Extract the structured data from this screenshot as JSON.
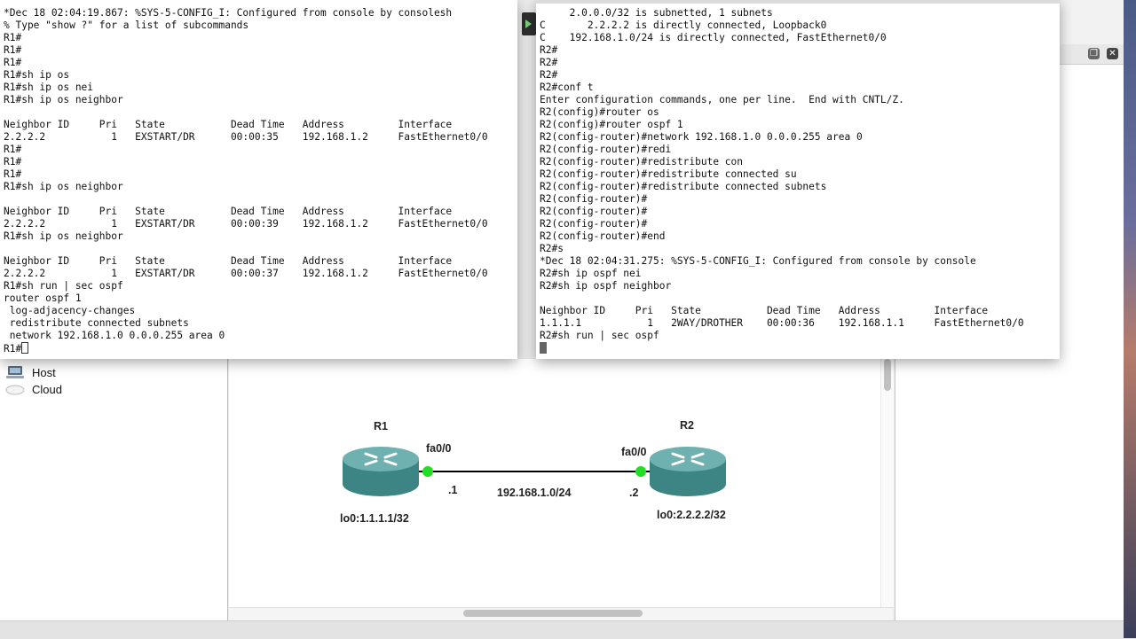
{
  "left_panel": {
    "devices": [
      {
        "label": "Host",
        "icon": "computer-icon"
      },
      {
        "label": "Cloud",
        "icon": "cloud-icon"
      }
    ]
  },
  "terminal_r1": {
    "lines": [
      "*Dec 18 02:04:19.867: %SYS-5-CONFIG_I: Configured from console by consolesh",
      "% Type \"show ?\" for a list of subcommands",
      "R1#",
      "R1#",
      "R1#",
      "R1#sh ip os",
      "R1#sh ip os nei",
      "R1#sh ip os neighbor",
      "",
      "Neighbor ID     Pri   State           Dead Time   Address         Interface",
      "2.2.2.2           1   EXSTART/DR      00:00:35    192.168.1.2     FastEthernet0/0",
      "R1#",
      "R1#",
      "R1#",
      "R1#sh ip os neighbor",
      "",
      "Neighbor ID     Pri   State           Dead Time   Address         Interface",
      "2.2.2.2           1   EXSTART/DR      00:00:39    192.168.1.2     FastEthernet0/0",
      "R1#sh ip os neighbor",
      "",
      "Neighbor ID     Pri   State           Dead Time   Address         Interface",
      "2.2.2.2           1   EXSTART/DR      00:00:37    192.168.1.2     FastEthernet0/0",
      "R1#sh run | sec ospf",
      "router ospf 1",
      " log-adjacency-changes",
      " redistribute connected subnets",
      " network 192.168.1.0 0.0.0.255 area 0"
    ],
    "prompt": "R1#"
  },
  "terminal_r2": {
    "lines": [
      "     2.0.0.0/32 is subnetted, 1 subnets",
      "C       2.2.2.2 is directly connected, Loopback0",
      "C    192.168.1.0/24 is directly connected, FastEthernet0/0",
      "R2#",
      "R2#",
      "R2#",
      "R2#conf t",
      "Enter configuration commands, one per line.  End with CNTL/Z.",
      "R2(config)#router os",
      "R2(config)#router ospf 1",
      "R2(config-router)#network 192.168.1.0 0.0.0.255 area 0",
      "R2(config-router)#redi",
      "R2(config-router)#redistribute con",
      "R2(config-router)#redistribute connected su",
      "R2(config-router)#redistribute connected subnets",
      "R2(config-router)#",
      "R2(config-router)#",
      "R2(config-router)#",
      "R2(config-router)#end",
      "R2#s",
      "*Dec 18 02:04:31.275: %SYS-5-CONFIG_I: Configured from console by console",
      "R2#sh ip ospf nei",
      "R2#sh ip ospf neighbor",
      "",
      "Neighbor ID     Pri   State           Dead Time   Address         Interface",
      "1.1.1.1           1   2WAY/DROTHER    00:00:36    192.168.1.1     FastEthernet0/0",
      "R2#sh run | sec ospf"
    ]
  },
  "topology": {
    "r1": {
      "name": "R1",
      "interface": "fa0/0",
      "host_octet": ".1",
      "loopback": "lo0:1.1.1.1/32"
    },
    "r2": {
      "name": "R2",
      "interface": "fa0/0",
      "host_octet": ".2",
      "loopback": "lo0:2.2.2.2/32"
    },
    "link_subnet": "192.168.1.0/24",
    "colors": {
      "router_body": "#3f8c8c",
      "link_up": "#22dd22",
      "link": "#000000"
    }
  }
}
